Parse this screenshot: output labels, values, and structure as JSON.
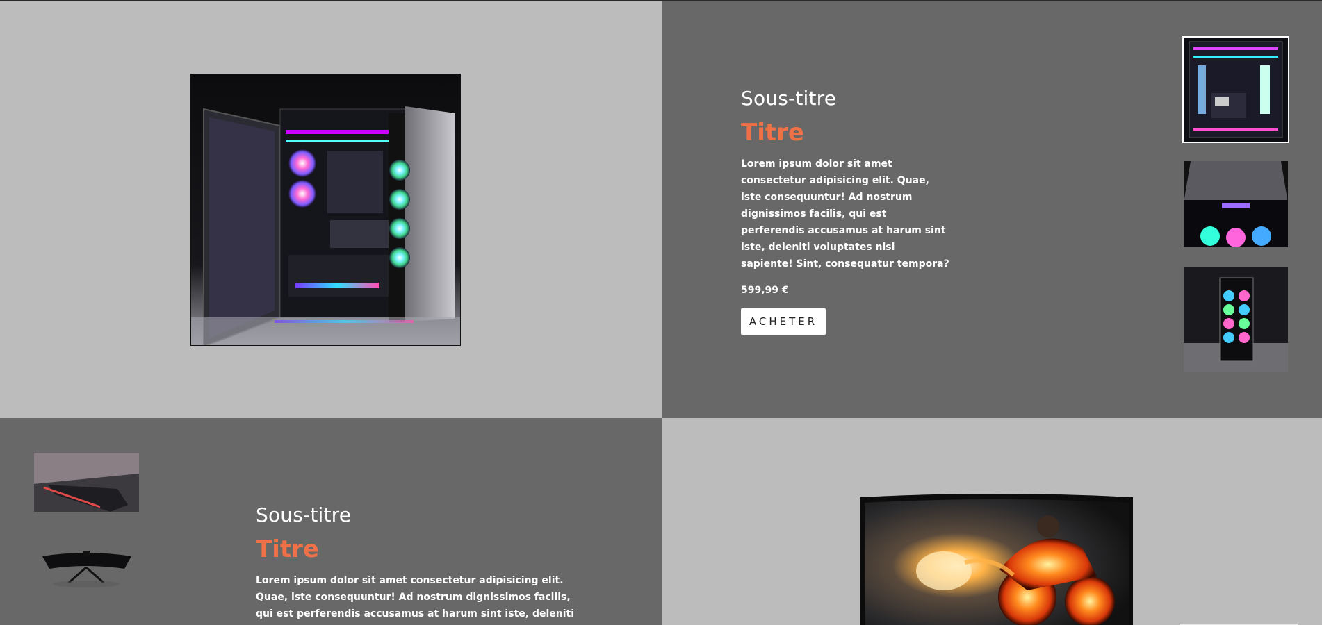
{
  "product1": {
    "subtitle": "Sous-titre",
    "title": "Titre",
    "description": "Lorem ipsum dolor sit amet consectetur adipisicing elit. Quae, iste consequuntur! Ad nostrum dignissimos facilis, qui est perferendis accusamus at harum sint iste, deleniti voluptates nisi sapiente! Sint, consequatur tempora?",
    "price": "599,99 €",
    "buy_label": "ACHETER",
    "main_image": "pc-tower-open-rgb",
    "thumbnails": [
      "pc-interior-watercooling",
      "pc-top-panel",
      "pc-front-fans"
    ]
  },
  "product2": {
    "subtitle": "Sous-titre",
    "title": "Titre",
    "description": "Lorem ipsum dolor sit amet consectetur adipisicing elit. Quae, iste consequuntur! Ad nostrum dignissimos facilis, qui est perferendis accusamus at harum sint iste, deleniti voluptates nisi sapiente! Sint,",
    "main_image": "curved-monitor-fire-motorbike",
    "thumbnails": [
      "monitor-detail-angle",
      "monitor-top-view"
    ]
  },
  "colors": {
    "light_panel": "#bcbcbc",
    "dark_panel": "#686868",
    "title_accent": "#ee7148",
    "button_bg": "#ffffff"
  }
}
